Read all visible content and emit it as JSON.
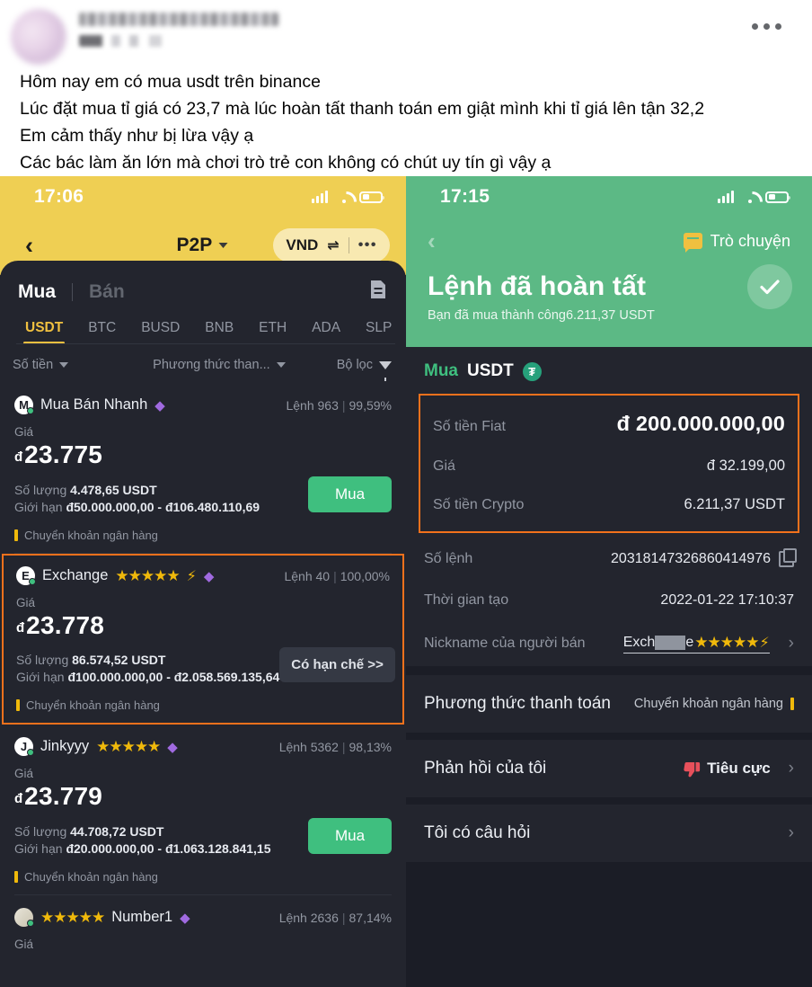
{
  "post": {
    "author_name_redacted": true,
    "menu_icon": "more-horizontal-icon",
    "lines": [
      "Hôm nay em có mua usdt trên binance",
      "Lúc đặt mua tỉ giá có 23,7 mà lúc hoàn tất thanh toán em giật mình khi tỉ giá lên tận 32,2",
      "Em cảm thấy như bị lừa vậy ạ",
      "Các  bác làm ăn lớn mà chơi trò trẻ con không có chút uy tín gì vậy ạ"
    ]
  },
  "colors": {
    "yellow_header": "#efcf53",
    "green_header": "#5cb985",
    "dark_panel": "#23252e",
    "dark_bg": "#1b1d26",
    "accent_green": "#3fbf7f",
    "accent_orange": "#f2711c",
    "accent_gold": "#f0b90b",
    "muted_text": "#9297a2"
  },
  "left_phone": {
    "status": {
      "time": "17:06",
      "signal_icon": "signal-bars-icon",
      "wifi_icon": "wifi-icon",
      "battery_icon": "battery-icon"
    },
    "nav": {
      "back_icon": "chevron-left-icon",
      "title": "P2P",
      "title_caret_icon": "chevron-down-icon",
      "currency": "VND",
      "swap_icon": "swap-arrows-icon",
      "more_icon": "more-horizontal-icon"
    },
    "mode_tabs": {
      "buy": "Mua",
      "sell": "Bán",
      "orders_icon": "document-icon"
    },
    "coin_tabs": [
      {
        "label": "USDT",
        "active": true
      },
      {
        "label": "BTC",
        "active": false
      },
      {
        "label": "BUSD",
        "active": false
      },
      {
        "label": "BNB",
        "active": false
      },
      {
        "label": "ETH",
        "active": false
      },
      {
        "label": "ADA",
        "active": false
      },
      {
        "label": "SLP",
        "active": false
      }
    ],
    "filters": {
      "amount": "Số tiền",
      "payment": "Phương thức than...",
      "filter": "Bộ lọc",
      "caret_icon": "chevron-down-icon",
      "funnel_icon": "filter-funnel-icon"
    },
    "labels": {
      "price": "Giá",
      "quantity": "Số lượng",
      "limit": "Giới hạn",
      "dong_symbol": "đ",
      "orders_word": "Lệnh",
      "payment_tag": "Chuyển khoản ngân hàng"
    },
    "offers": [
      {
        "avatar_initial": "M",
        "merchant": "Mua Bán Nhanh",
        "stars": "",
        "has_bolt": false,
        "verified_icon": "verified-diamond-icon",
        "orders": "Lệnh 963",
        "completion": "99,59%",
        "price": "23.775",
        "quantity": "4.478,65",
        "quantity_unit": "USDT",
        "limit": "đ50.000.000,00 - đ106.480.110,69",
        "button": "Mua",
        "button_kind": "buy",
        "payment": "Chuyển khoản ngân hàng",
        "highlighted": false
      },
      {
        "avatar_initial": "E",
        "merchant": "Exchange",
        "stars": "★★★★★",
        "has_bolt": true,
        "verified_icon": "verified-diamond-icon",
        "orders": "Lệnh 40",
        "completion": "100,00%",
        "price": "23.778",
        "quantity": "86.574,52",
        "quantity_unit": "USDT",
        "limit": "đ100.000.000,00 - đ2.058.569.135,64",
        "button": "Có hạn chế >>",
        "button_kind": "limited",
        "payment": "Chuyển khoản ngân hàng",
        "highlighted": true
      },
      {
        "avatar_initial": "J",
        "merchant": "Jinkyyy",
        "stars": "★★★★★",
        "has_bolt": false,
        "verified_icon": "verified-diamond-icon",
        "orders": "Lệnh 5362",
        "completion": "98,13%",
        "price": "23.779",
        "quantity": "44.708,72",
        "quantity_unit": "USDT",
        "limit": "đ20.000.000,00 - đ1.063.128.841,15",
        "button": "Mua",
        "button_kind": "buy",
        "payment": "Chuyển khoản ngân hàng",
        "highlighted": false
      },
      {
        "avatar_initial": "",
        "merchant": "Number1",
        "stars": "★★★★★",
        "has_bolt": false,
        "verified_icon": "verified-diamond-icon",
        "orders": "Lệnh 2636",
        "completion": "87,14%",
        "price": "",
        "quantity": "",
        "quantity_unit": "",
        "limit": "",
        "button": "",
        "button_kind": "none",
        "payment": "",
        "highlighted": false,
        "partial": true
      }
    ]
  },
  "right_phone": {
    "status": {
      "time": "17:15",
      "signal_icon": "signal-bars-icon",
      "wifi_icon": "wifi-icon",
      "battery_icon": "battery-icon"
    },
    "nav": {
      "back_icon": "chevron-left-icon",
      "chat_label": "Trò chuyện",
      "chat_icon": "chat-bubble-icon"
    },
    "header": {
      "title": "Lệnh đã hoàn tất",
      "subtitle": "Bạn đã mua thành công6.211,37 USDT",
      "success_icon": "check-circle-icon"
    },
    "trade": {
      "side": "Mua",
      "coin": "USDT",
      "coin_icon": "tether-icon"
    },
    "amounts": [
      {
        "label": "Số tiền Fiat",
        "value": "đ 200.000.000,00",
        "emphasis": true
      },
      {
        "label": "Giá",
        "value": "đ 32.199,00",
        "emphasis": false
      },
      {
        "label": "Số tiền Crypto",
        "value": "6.211,37 USDT",
        "emphasis": false
      }
    ],
    "info": [
      {
        "label": "Số lệnh",
        "value": "20318147326860414976",
        "icon": "copy-icon"
      },
      {
        "label": "Thời gian tạo",
        "value": "2022-01-22 17:10:37",
        "icon": ""
      },
      {
        "label": "Nickname của người bán",
        "value_prefix": "Exch",
        "value_suffix": "e",
        "stars": "★★★★★",
        "has_bolt": true,
        "icon": "chevron-right-icon",
        "redacted": true
      }
    ],
    "rows": [
      {
        "label": "Phương thức thanh toán",
        "value": "Chuyển khoản ngân hàng",
        "marker_icon": "yellow-bar-icon",
        "chevron": false
      },
      {
        "label": "Phản hồi của tôi",
        "value": "Tiêu cực",
        "marker_icon": "thumbs-down-icon",
        "chevron": true
      },
      {
        "label": "Tôi có câu hỏi",
        "value": "",
        "marker_icon": "",
        "chevron": true
      }
    ]
  }
}
